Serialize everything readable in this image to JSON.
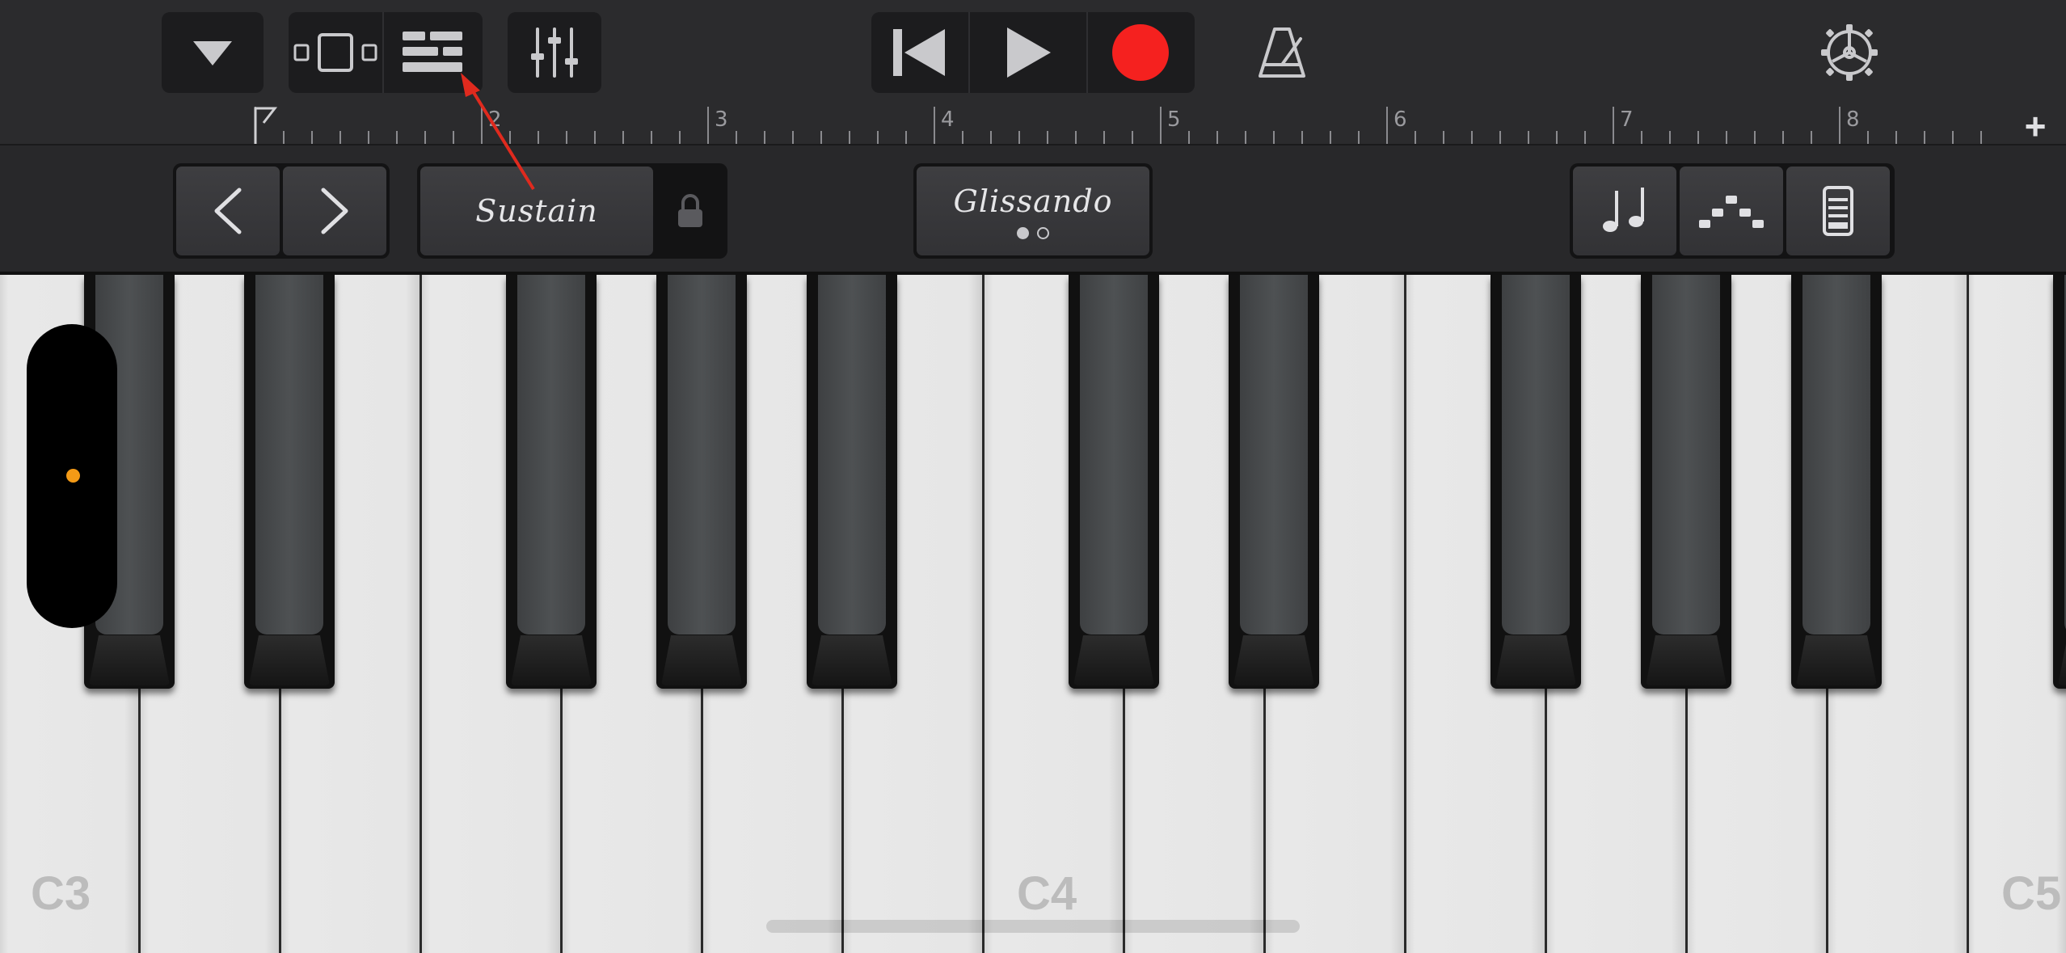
{
  "toolbar": {
    "icons": [
      "dropdown-triangle-icon",
      "single-view-icon",
      "tracks-view-icon",
      "mixer-icon",
      "rewind-icon",
      "play-icon",
      "record-icon",
      "metronome-icon",
      "settings-gear-icon"
    ],
    "colors": {
      "record": "#f5211f",
      "icon": "#c9c9cc",
      "group_bg": "#1c1c1e"
    }
  },
  "ruler": {
    "bars": [
      "2",
      "3",
      "4",
      "5",
      "6",
      "7",
      "8"
    ],
    "add_label": "+"
  },
  "controls": {
    "sustain_label": "Sustain",
    "glissando_label": "Glissando",
    "glissando_pages": 2,
    "icons": [
      "chevron-left-icon",
      "chevron-right-icon",
      "lock-icon",
      "notes-icon",
      "arpeggiator-icon",
      "keyboard-layout-icon"
    ]
  },
  "keyboard": {
    "octave_labels": {
      "c3": "C3",
      "c4": "C4",
      "c5": "C5"
    },
    "pitch_dot_color": "#f49a16"
  }
}
